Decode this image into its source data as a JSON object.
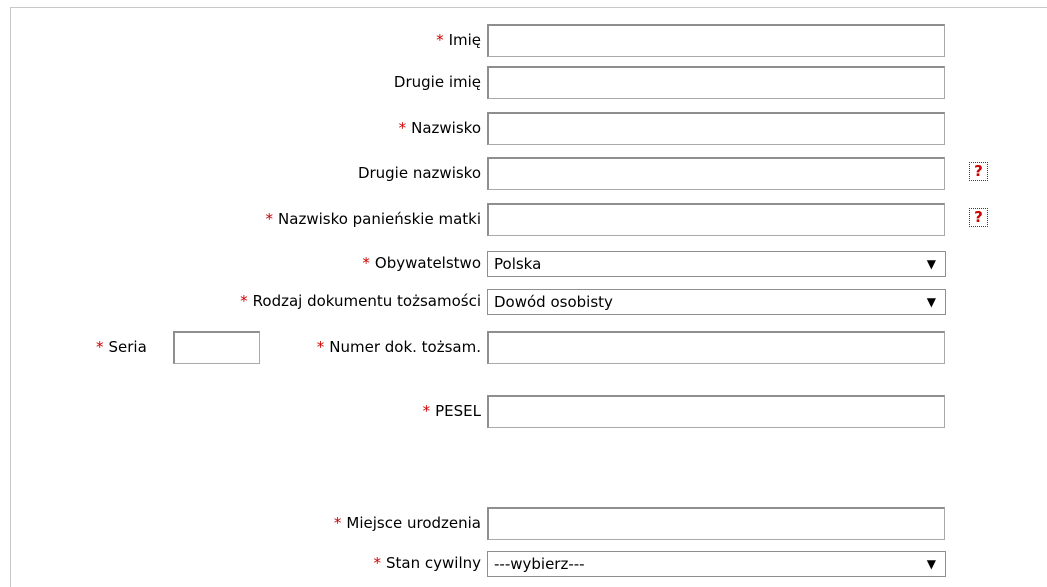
{
  "required_marker": "*",
  "help_icon_glyph": "?",
  "fields": {
    "first_name": {
      "label": "Imię",
      "value": ""
    },
    "middle_name": {
      "label": "Drugie imię",
      "value": ""
    },
    "last_name": {
      "label": "Nazwisko",
      "value": ""
    },
    "second_last_name": {
      "label": "Drugie nazwisko",
      "value": ""
    },
    "mother_maiden_name": {
      "label": "Nazwisko panieńskie matki",
      "value": ""
    },
    "citizenship": {
      "label": "Obywatelstwo",
      "selected": "Polska"
    },
    "id_document_type": {
      "label": "Rodzaj dokumentu tożsamości",
      "selected": "Dowód osobisty"
    },
    "series": {
      "label": "Seria",
      "value": ""
    },
    "id_document_number": {
      "label": "Numer dok. tożsam.",
      "value": ""
    },
    "pesel": {
      "label": "PESEL",
      "value": ""
    },
    "birth_place": {
      "label": "Miejsce urodzenia",
      "value": ""
    },
    "marital_status": {
      "label": "Stan cywilny",
      "selected": "---wybierz---"
    }
  },
  "select_arrow": "▼"
}
